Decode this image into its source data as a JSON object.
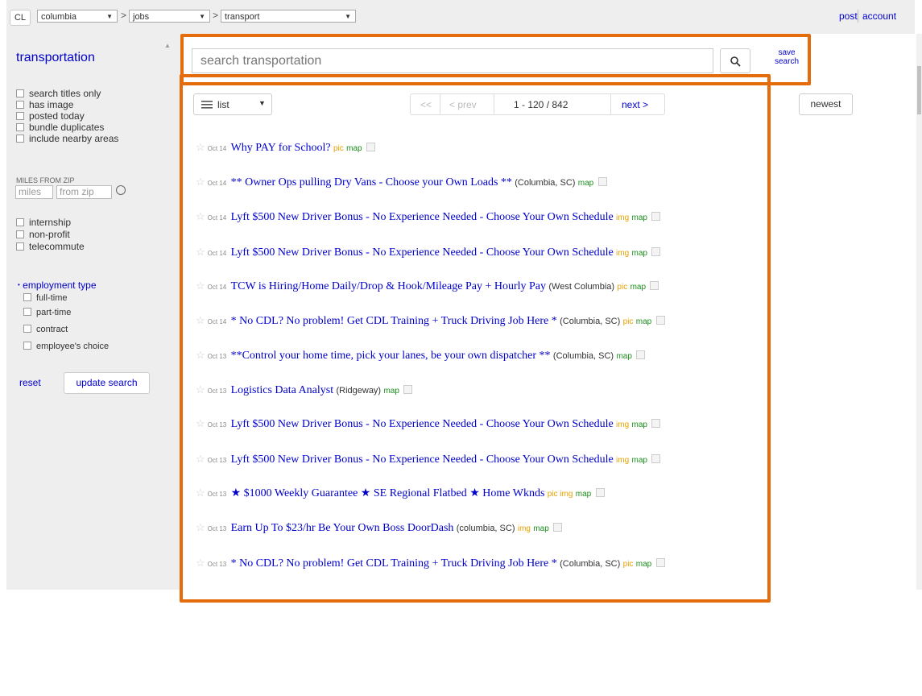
{
  "topbar": {
    "logo": "CL",
    "area": "columbia",
    "category": "jobs",
    "subcategory": "transport",
    "separator": ">",
    "post": "post",
    "account": "account"
  },
  "sidebar": {
    "title": "transportation",
    "options": [
      "search titles only",
      "has image",
      "posted today",
      "bundle duplicates",
      "include nearby areas"
    ],
    "miles_label": "MILES FROM ZIP",
    "miles_placeholder": "miles",
    "zip_placeholder": "from zip",
    "extras": [
      "internship",
      "non-profit",
      "telecommute"
    ],
    "employment_title": "employment type",
    "employment_options": [
      "full-time",
      "part-time",
      "contract",
      "employee's choice"
    ],
    "reset": "reset",
    "update": "update search"
  },
  "search": {
    "placeholder": "search transportation",
    "save_line1": "save",
    "save_line2": "search"
  },
  "toolbar": {
    "view": "list",
    "first": "<<",
    "prev": "< prev",
    "range": "1 - 120 / 842",
    "next": "next >",
    "sort": "newest"
  },
  "results": [
    {
      "date": "Oct 14",
      "title": "Why PAY for School?",
      "hood": "",
      "pic": "pic",
      "map": "map"
    },
    {
      "date": "Oct 14",
      "title": "** Owner Ops pulling Dry Vans - Choose your Own Loads **",
      "hood": "(Columbia, SC)",
      "pic": "",
      "map": "map"
    },
    {
      "date": "Oct 14",
      "title": "Lyft $500 New Driver Bonus - No Experience Needed - Choose Your Own Schedule",
      "hood": "",
      "pic": "img",
      "map": "map"
    },
    {
      "date": "Oct 14",
      "title": "Lyft $500 New Driver Bonus - No Experience Needed - Choose Your Own Schedule",
      "hood": "",
      "pic": "img",
      "map": "map"
    },
    {
      "date": "Oct 14",
      "title": "TCW is Hiring/Home Daily/Drop & Hook/Mileage Pay + Hourly Pay",
      "hood": "(West Columbia)",
      "pic": "pic",
      "map": "map"
    },
    {
      "date": "Oct 14",
      "title": "* No CDL? No problem! Get CDL Training + Truck Driving Job Here *",
      "hood": "(Columbia, SC)",
      "pic": "pic",
      "map": "map"
    },
    {
      "date": "Oct 13",
      "title": "**Control your home time, pick your lanes, be your own dispatcher **",
      "hood": "(Columbia, SC)",
      "pic": "",
      "map": "map"
    },
    {
      "date": "Oct 13",
      "title": "Logistics Data Analyst",
      "hood": "(Ridgeway)",
      "pic": "",
      "map": "map"
    },
    {
      "date": "Oct 13",
      "title": "Lyft $500 New Driver Bonus - No Experience Needed - Choose Your Own Schedule",
      "hood": "",
      "pic": "img",
      "map": "map"
    },
    {
      "date": "Oct 13",
      "title": "Lyft $500 New Driver Bonus - No Experience Needed - Choose Your Own Schedule",
      "hood": "",
      "pic": "img",
      "map": "map"
    },
    {
      "date": "Oct 13",
      "title": "★ $1000 Weekly Guarantee ★ SE Regional Flatbed ★ Home Wknds",
      "hood": "",
      "pic": "pic img",
      "map": "map"
    },
    {
      "date": "Oct 13",
      "title": "Earn Up To $23/hr Be Your Own Boss DoorDash",
      "hood": "(columbia, SC)",
      "pic": "img",
      "map": "map"
    },
    {
      "date": "Oct 13",
      "title": "* No CDL? No problem! Get CDL Training + Truck Driving Job Here *",
      "hood": "(Columbia, SC)",
      "pic": "pic",
      "map": "map"
    }
  ],
  "colors": {
    "link": "#0000cc",
    "highlight": "#e46c0a",
    "pic_tag": "#e9a100",
    "map_tag": "#1c8e1c"
  }
}
